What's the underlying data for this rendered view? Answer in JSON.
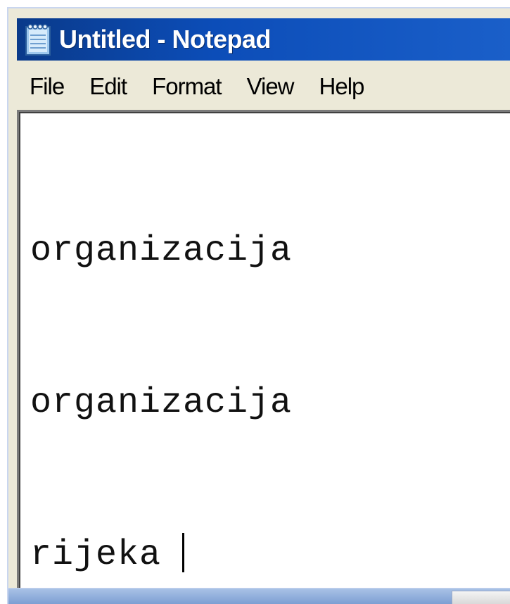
{
  "window": {
    "title": "Untitled - Notepad",
    "icon": "notepad-icon"
  },
  "menu": {
    "items": [
      {
        "label": "File"
      },
      {
        "label": "Edit"
      },
      {
        "label": "Format"
      },
      {
        "label": "View"
      },
      {
        "label": "Help"
      }
    ]
  },
  "editor": {
    "lines": [
      "organizacija",
      "organizacija",
      "rijeka"
    ]
  },
  "colors": {
    "titlebar": "#0c4db8",
    "titlebar_text": "#ffffff",
    "menubar": "#ece9d8",
    "editor_bg": "#ffffff",
    "taskbar": "#7d9fd3"
  }
}
